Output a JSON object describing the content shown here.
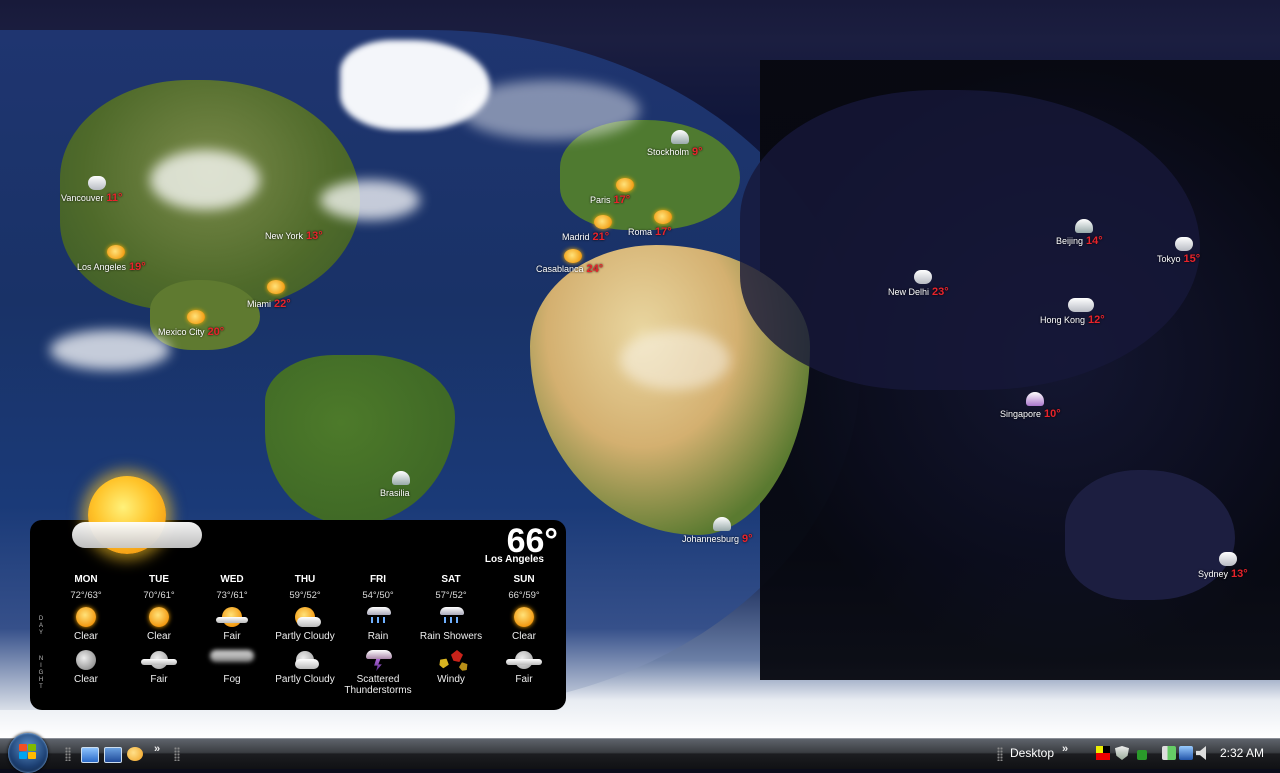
{
  "map": {
    "cities": [
      {
        "name": "Vancouver",
        "temp": "11°",
        "icon": "cloudy-icon"
      },
      {
        "name": "Los Angeles",
        "temp": "19°",
        "icon": "fair-icon"
      },
      {
        "name": "New York",
        "temp": "13°",
        "icon": "rain-icon"
      },
      {
        "name": "Miami",
        "temp": "22°",
        "icon": "sun-icon"
      },
      {
        "name": "Mexico City",
        "temp": "20°",
        "icon": "sun-icon"
      },
      {
        "name": "Brasilia",
        "temp": "",
        "icon": "rain-icon"
      },
      {
        "name": "Stockholm",
        "temp": "9°",
        "icon": "rain-icon"
      },
      {
        "name": "Paris",
        "temp": "17°",
        "icon": "fair-icon"
      },
      {
        "name": "Madrid",
        "temp": "21°",
        "icon": "sun-icon"
      },
      {
        "name": "Roma",
        "temp": "17°",
        "icon": "fair-icon"
      },
      {
        "name": "Casablanca",
        "temp": "24°",
        "icon": "fair-icon"
      },
      {
        "name": "Johannesburg",
        "temp": "9°",
        "icon": "rain-icon"
      },
      {
        "name": "Beijing",
        "temp": "14°",
        "icon": "rain-icon"
      },
      {
        "name": "Tokyo",
        "temp": "15°",
        "icon": "cloudy-icon"
      },
      {
        "name": "New Delhi",
        "temp": "23°",
        "icon": "cloudy-icon"
      },
      {
        "name": "Hong Kong",
        "temp": "12°",
        "icon": "fog-icon"
      },
      {
        "name": "Singapore",
        "temp": "10°",
        "icon": "thunderstorm-icon"
      },
      {
        "name": "Sydney",
        "temp": "13°",
        "icon": "cloudy-icon"
      }
    ]
  },
  "widget": {
    "current_temp": "66°",
    "city": "Los Angeles",
    "current_icon": "partly-cloudy-sun-icon",
    "day_label": "DAY",
    "night_label": "NIGHT",
    "forecast": [
      {
        "day": "MON",
        "hilo": "72°/63°",
        "day_icon": "sun",
        "day_cond": "Clear",
        "night_icon": "moon",
        "night_cond": "Clear"
      },
      {
        "day": "TUE",
        "hilo": "70°/61°",
        "day_icon": "sun",
        "day_cond": "Clear",
        "night_icon": "mfair",
        "night_cond": "Fair"
      },
      {
        "day": "WED",
        "hilo": "73°/61°",
        "day_icon": "fair",
        "day_cond": "Fair",
        "night_icon": "fog",
        "night_cond": "Fog"
      },
      {
        "day": "THU",
        "hilo": "59°/52°",
        "day_icon": "pc",
        "day_cond": "Partly Cloudy",
        "night_icon": "mpc",
        "night_cond": "Partly Cloudy"
      },
      {
        "day": "FRI",
        "hilo": "54°/50°",
        "day_icon": "rain",
        "day_cond": "Rain",
        "night_icon": "ts",
        "night_cond": "Scattered Thunderstorms"
      },
      {
        "day": "SAT",
        "hilo": "57°/52°",
        "day_icon": "rain",
        "day_cond": "Rain Showers",
        "night_icon": "wind",
        "night_cond": "Windy"
      },
      {
        "day": "SUN",
        "hilo": "66°/59°",
        "day_icon": "sun",
        "day_cond": "Clear",
        "night_icon": "mfair",
        "night_cond": "Fair"
      }
    ]
  },
  "taskbar": {
    "start_label": "Start",
    "quick_launch": [
      "show-desktop-icon",
      "switch-windows-icon",
      "media-player-icon"
    ],
    "overflow": "»",
    "desktop_toolbar": "Desktop",
    "desktop_overflow": "»",
    "tray": [
      "windows-flag-tray-icon",
      "security-shield-icon",
      "update-icon",
      "power-icon",
      "network-icon",
      "volume-icon"
    ],
    "clock": "2:32 AM"
  },
  "colors": {
    "temp_red": "#e8232b",
    "widget_bg": "#000000"
  }
}
